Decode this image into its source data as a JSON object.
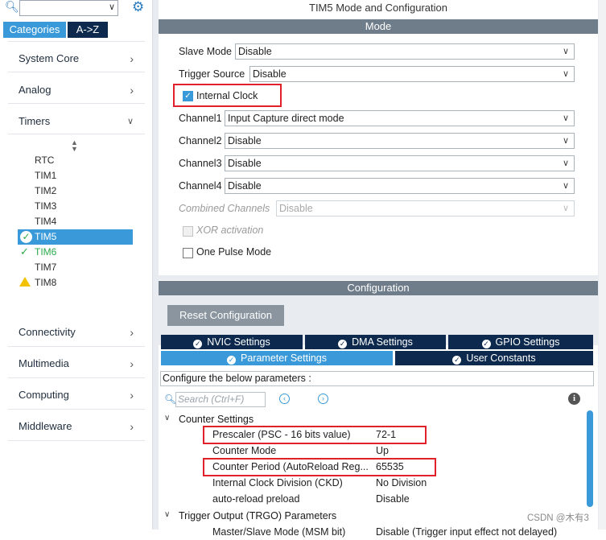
{
  "left": {
    "tabs": {
      "categories": "Categories",
      "az": "A->Z"
    },
    "nav": {
      "system_core": "System Core",
      "analog": "Analog",
      "timers": "Timers",
      "connectivity": "Connectivity",
      "multimedia": "Multimedia",
      "computing": "Computing",
      "middleware": "Middleware"
    },
    "timers": [
      "RTC",
      "TIM1",
      "TIM2",
      "TIM3",
      "TIM4",
      "TIM5",
      "TIM6",
      "TIM7",
      "TIM8"
    ]
  },
  "mode_panel": {
    "title": "TIM5 Mode and Configuration",
    "section": "Mode",
    "slave_mode": {
      "label": "Slave Mode",
      "value": "Disable"
    },
    "trigger_source": {
      "label": "Trigger Source",
      "value": "Disable"
    },
    "internal_clock": {
      "label": "Internal Clock",
      "checked": true
    },
    "channel1": {
      "label": "Channel1",
      "value": "Input Capture direct mode"
    },
    "channel2": {
      "label": "Channel2",
      "value": "Disable"
    },
    "channel3": {
      "label": "Channel3",
      "value": "Disable"
    },
    "channel4": {
      "label": "Channel4",
      "value": "Disable"
    },
    "combined": {
      "label": "Combined Channels",
      "value": "Disable"
    },
    "xor": {
      "label": "XOR activation"
    },
    "one_pulse": {
      "label": "One Pulse Mode",
      "checked": false
    }
  },
  "config_panel": {
    "section": "Configuration",
    "reset_button": "Reset Configuration",
    "tabs": {
      "nvic": "NVIC Settings",
      "dma": "DMA Settings",
      "gpio": "GPIO Settings",
      "parameter": "Parameter Settings",
      "user_constants": "User Constants"
    },
    "instruction": "Configure the below parameters :",
    "search_placeholder": "Search (Ctrl+F)",
    "counter_settings": "Counter Settings",
    "params": [
      {
        "name": "Prescaler (PSC - 16 bits value)",
        "value": "72-1"
      },
      {
        "name": "Counter Mode",
        "value": "Up"
      },
      {
        "name": "Counter Period (AutoReload Reg...",
        "value": "65535"
      },
      {
        "name": "Internal Clock Division (CKD)",
        "value": "No Division"
      },
      {
        "name": "auto-reload preload",
        "value": "Disable"
      }
    ],
    "trgo": "Trigger Output (TRGO) Parameters",
    "trgo_partial_name": "Master/Slave Mode (MSM bit)",
    "trgo_partial_value": "Disable (Trigger input effect not delayed)"
  },
  "watermark": "CSDN @木有3",
  "colors": {
    "accent": "#3a9ad9",
    "dark_tab": "#0d2a4e",
    "header": "#6f7c8a",
    "highlight_red": "#e0202a",
    "ok_green": "#2aa84a",
    "warn_yellow": "#f2c200"
  }
}
